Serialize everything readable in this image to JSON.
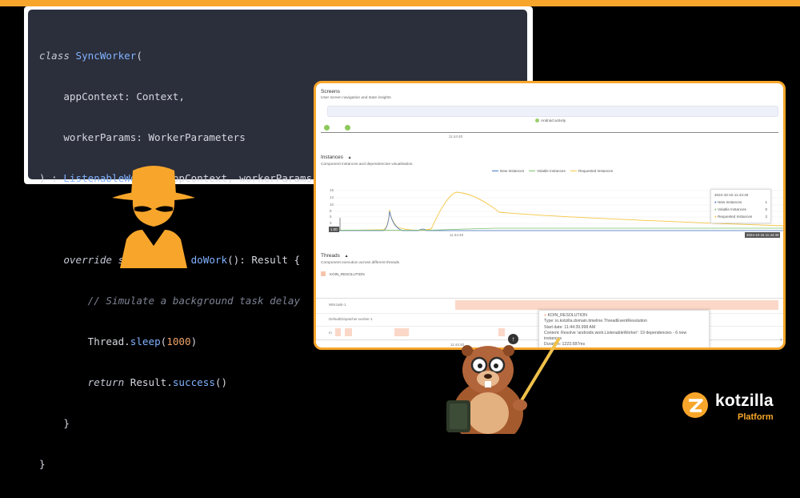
{
  "code": {
    "lines": [
      [
        "class ",
        "SyncWorker",
        "("
      ],
      [
        "    appContext: Context,"
      ],
      [
        "    workerParams: WorkerParameters"
      ],
      [
        ") : ",
        "ListenableWorker",
        "(appContext, workerParams) {"
      ],
      [
        ""
      ],
      [
        "    ",
        "override suspend fun ",
        "doWork",
        "(): Result {"
      ],
      [
        "        // Simulate a background task delay"
      ],
      [
        "        Thread.",
        "sleep",
        "(",
        "1000",
        ")"
      ],
      [
        "        ",
        "return ",
        "Result.",
        "success",
        "()"
      ],
      [
        "    }"
      ],
      [
        "}"
      ]
    ]
  },
  "screens": {
    "title": "Screens",
    "subtitle": "User screen navigation and state insights",
    "legend": "Android activity",
    "time": "11:44:40"
  },
  "instances": {
    "title": "Instances",
    "subtitle": "Component instances and dependencies visualisation.",
    "legend": [
      "New Instances",
      "Volatile Instances",
      "Requested Instances"
    ],
    "y_ticks": [
      "15",
      "13",
      "10",
      "8",
      "5",
      "3"
    ],
    "cursor_value": "1.00",
    "time": "11:44:40",
    "timestamp_badge": "2024-10-15 11:44:40",
    "tooltip": {
      "time": "2024-10-15 11:44:40",
      "rows": [
        {
          "label": "New Instances",
          "value": "1",
          "color": "#4a78c9"
        },
        {
          "label": "Volatile Instances",
          "value": "0",
          "color": "#7ac36a"
        },
        {
          "label": "Requested Instances",
          "value": "2",
          "color": "#f5c542"
        }
      ]
    }
  },
  "threads": {
    "title": "Threads",
    "subtitle": "Component execution across different threads",
    "legend": "KOIN_RESOLUTION",
    "rows": [
      "WM.task-1",
      "DefaultDispatcher-worker-1",
      "m"
    ],
    "time": "11:44:40",
    "end_label": "7",
    "tooltip": {
      "title": "KOIN_RESOLUTION",
      "type": "Type: io.kotzilla.domain.timeline.ThreadEventResolution",
      "start": "Start date: 11:44:39.998 AM",
      "content": "Content: Resolve 'androidx.work.ListenableWorker': 19 dependencies - 6 new instances",
      "duration": "Duration: 1223.587ms"
    }
  },
  "brand": {
    "name": "kotzilla",
    "sub": "Platform",
    "accent": "#f7a62b"
  },
  "icons": [
    "spy-icon",
    "scroll-up-icon",
    "kotzilla-logo",
    "beaver-mascot"
  ]
}
